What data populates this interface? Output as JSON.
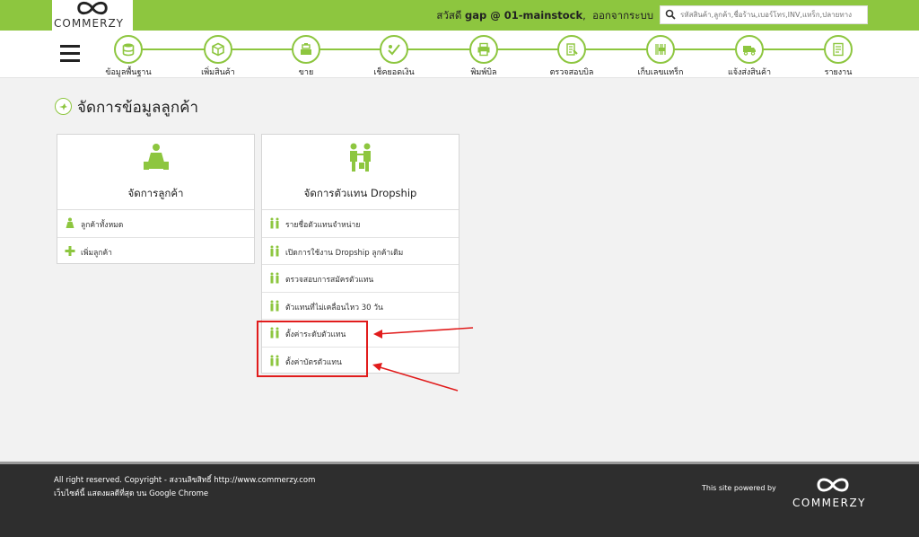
{
  "brand": {
    "name": "COMMERZY"
  },
  "topbar": {
    "greeting_prefix": "สวัสดี",
    "username": "gap @ 01-mainstock",
    "logout": "ออกจากระบบ",
    "search_placeholder": "รหัสสินค้า,ลูกค้า,ชื่อร้าน,เบอร์โทร,INV,แทร็ก,ปลายทาง"
  },
  "nav": {
    "items": [
      {
        "label": "ข้อมูลพื้นฐาน",
        "icon": "database-icon"
      },
      {
        "label": "เพิ่มสินค้า",
        "icon": "box-icon"
      },
      {
        "label": "ขาย",
        "icon": "cash-register-icon"
      },
      {
        "label": "เช็คยอดเงิน",
        "icon": "check-money-icon"
      },
      {
        "label": "พิมพ์บิล",
        "icon": "printer-icon"
      },
      {
        "label": "ตรวจสอบบิล",
        "icon": "scan-bill-icon"
      },
      {
        "label": "เก็บเลขแทร็ก",
        "icon": "scan-track-icon"
      },
      {
        "label": "แจ้งส่งสินค้า",
        "icon": "truck-icon"
      },
      {
        "label": "รายงาน",
        "icon": "report-icon"
      }
    ]
  },
  "page": {
    "title": "จัดการข้อมูลลูกค้า"
  },
  "cards": {
    "customers": {
      "title": "จัดการลูกค้า",
      "items": [
        {
          "label": "ลูกค้าทั้งหมด",
          "icon": "customer-icon"
        },
        {
          "label": "เพิ่มลูกค้า",
          "icon": "plus-icon"
        }
      ]
    },
    "dropship": {
      "title": "จัดการตัวแทน Dropship",
      "items": [
        {
          "label": "รายชื่อตัวแทนจำหน่าย",
          "icon": "agent-icon"
        },
        {
          "label": "เปิดการใช้งาน Dropship ลูกค้าเดิม",
          "icon": "agent-icon"
        },
        {
          "label": "ตรวจสอบการสมัครตัวแทน",
          "icon": "agent-icon"
        },
        {
          "label": "ตัวแทนที่ไม่เคลื่อนไหว 30 วัน",
          "icon": "agent-icon"
        },
        {
          "label": "ตั้งค่าระดับตัวแทน",
          "icon": "agent-icon"
        },
        {
          "label": "ตั้งค่าบัตรตัวแทน",
          "icon": "agent-icon"
        }
      ]
    }
  },
  "footer": {
    "line1": "All right reserved. Copyright - สงวนลิขสิทธิ์ http://www.commerzy.com",
    "line2": "เว็บไซต์นี้ แสดงผลดีที่สุด บน Google Chrome",
    "powered": "This site powered by"
  },
  "colors": {
    "accent": "#8dc63f",
    "annotation": "#e11c1c",
    "footer_bg": "#2e2e2e"
  }
}
